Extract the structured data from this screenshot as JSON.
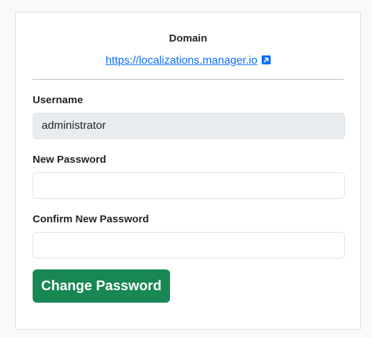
{
  "domain": {
    "title": "Domain",
    "url": "https://localizations.manager.io",
    "link_icon": "external-link-icon"
  },
  "form": {
    "username": {
      "label": "Username",
      "value": "administrator"
    },
    "new_password": {
      "label": "New Password",
      "value": ""
    },
    "confirm_password": {
      "label": "Confirm New Password",
      "value": ""
    },
    "submit_label": "Change Password"
  },
  "colors": {
    "accent": "#198754",
    "link": "#0d6efd",
    "readonly_bg": "#e9ecef"
  }
}
